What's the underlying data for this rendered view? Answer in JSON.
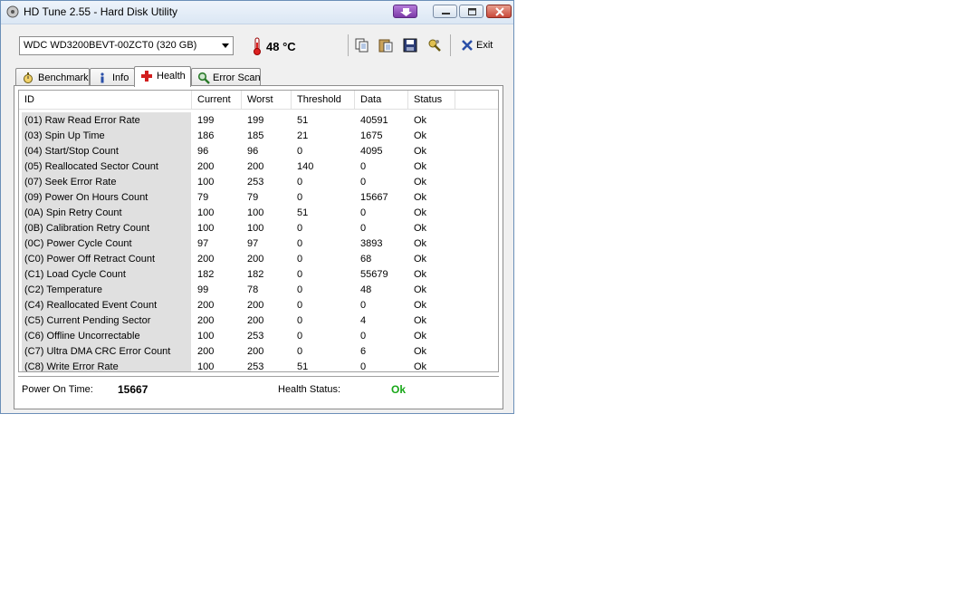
{
  "window": {
    "title": "HD Tune 2.55 - Hard Disk Utility"
  },
  "toolbar": {
    "drive": "WDC WD3200BEVT-00ZCT0 (320 GB)",
    "temperature": "48",
    "temperature_unit": "°C",
    "exit_label": "Exit"
  },
  "tabs": [
    {
      "label": "Benchmark",
      "icon": "stopwatch-icon"
    },
    {
      "label": "Info",
      "icon": "info-icon"
    },
    {
      "label": "Health",
      "icon": "red-cross-icon"
    },
    {
      "label": "Error Scan",
      "icon": "magnifier-icon"
    }
  ],
  "active_tab": "Health",
  "columns": [
    "ID",
    "Current",
    "Worst",
    "Threshold",
    "Data",
    "Status"
  ],
  "rows": [
    [
      "(01) Raw Read Error Rate",
      "199",
      "199",
      "51",
      "40591",
      "Ok"
    ],
    [
      "(03) Spin Up Time",
      "186",
      "185",
      "21",
      "1675",
      "Ok"
    ],
    [
      "(04) Start/Stop Count",
      "96",
      "96",
      "0",
      "4095",
      "Ok"
    ],
    [
      "(05) Reallocated Sector Count",
      "200",
      "200",
      "140",
      "0",
      "Ok"
    ],
    [
      "(07) Seek Error Rate",
      "100",
      "253",
      "0",
      "0",
      "Ok"
    ],
    [
      "(09) Power On Hours Count",
      "79",
      "79",
      "0",
      "15667",
      "Ok"
    ],
    [
      "(0A) Spin Retry Count",
      "100",
      "100",
      "51",
      "0",
      "Ok"
    ],
    [
      "(0B) Calibration Retry Count",
      "100",
      "100",
      "0",
      "0",
      "Ok"
    ],
    [
      "(0C) Power Cycle Count",
      "97",
      "97",
      "0",
      "3893",
      "Ok"
    ],
    [
      "(C0) Power Off Retract Count",
      "200",
      "200",
      "0",
      "68",
      "Ok"
    ],
    [
      "(C1) Load Cycle Count",
      "182",
      "182",
      "0",
      "55679",
      "Ok"
    ],
    [
      "(C2) Temperature",
      "99",
      "78",
      "0",
      "48",
      "Ok"
    ],
    [
      "(C4) Reallocated Event Count",
      "200",
      "200",
      "0",
      "0",
      "Ok"
    ],
    [
      "(C5) Current Pending Sector",
      "200",
      "200",
      "0",
      "4",
      "Ok"
    ],
    [
      "(C6) Offline Uncorrectable",
      "100",
      "253",
      "0",
      "0",
      "Ok"
    ],
    [
      "(C7) Ultra DMA CRC Error Count",
      "200",
      "200",
      "0",
      "6",
      "Ok"
    ],
    [
      "(C8) Write Error Rate",
      "100",
      "253",
      "51",
      "0",
      "Ok"
    ]
  ],
  "footer": {
    "power_on_label": "Power On Time:",
    "power_on_value": "15667",
    "health_label": "Health Status:",
    "health_value": "Ok"
  },
  "colors": {
    "ok_green": "#18a818",
    "id_column_shade": "#e0e0e0"
  }
}
